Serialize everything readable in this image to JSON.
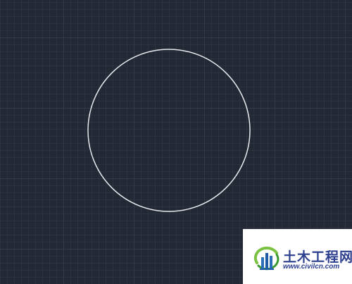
{
  "canvas": {
    "background_color": "#222834",
    "minor_grid_color": "#2b3240",
    "major_grid_color": "#323a49",
    "entities": [
      {
        "type": "circle",
        "stroke_color": "#e8eaee"
      }
    ]
  },
  "watermark": {
    "title": "土木工程网",
    "url": "www.civilcn.com",
    "text_color": "#2d3f8f",
    "logo_icon": "civilcn-logo-icon"
  }
}
